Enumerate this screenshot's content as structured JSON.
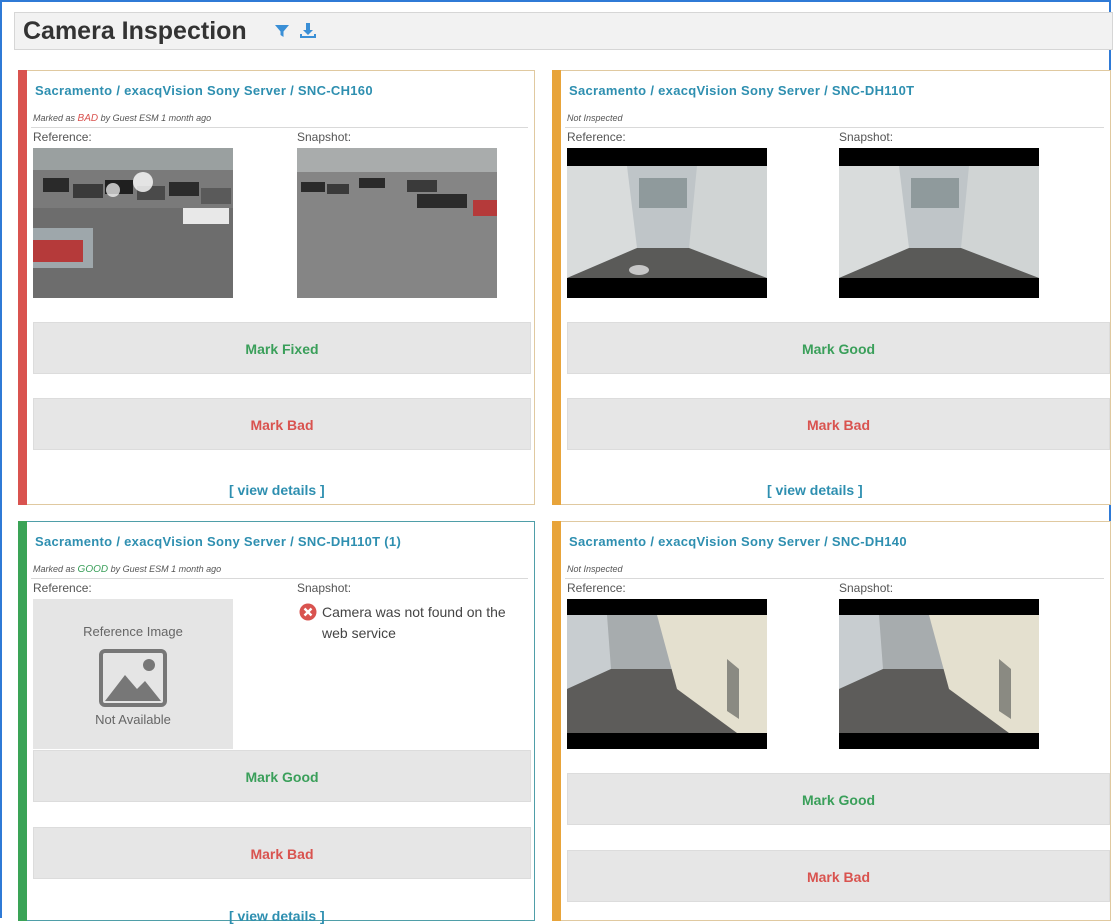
{
  "header": {
    "title": "Camera Inspection",
    "filter_icon": "filter-icon",
    "export_icon": "download-icon"
  },
  "labels": {
    "reference": "Reference:",
    "snapshot": "Snapshot:"
  },
  "colors": {
    "bad": "#d9534f",
    "good": "#3a9f5a",
    "uninspected": "#e8a43a",
    "link": "#2e8fb0"
  },
  "cameras": [
    {
      "title": "Sacramento / exacqVision Sony Server / SNC-CH160",
      "status_prefix": "Marked as",
      "status_value": "BAD",
      "status_suffix": "by Guest ESM 1 month ago",
      "primary_action": "Mark Fixed",
      "secondary_action": "Mark Bad",
      "details_link": "[ view details ]"
    },
    {
      "title": "Sacramento / exacqVision Sony Server / SNC-DH110T",
      "status_text": "Not Inspected",
      "primary_action": "Mark Good",
      "secondary_action": "Mark Bad",
      "details_link": "[ view details ]"
    },
    {
      "title": "Sacramento / exacqVision Sony Server / SNC-DH110T (1)",
      "status_prefix": "Marked as",
      "status_value": "GOOD",
      "status_suffix": "by Guest ESM 1 month ago",
      "reference_placeholder_title": "Reference Image",
      "reference_placeholder_caption": "Not Available",
      "snapshot_error": "Camera was not found on the web service",
      "primary_action": "Mark Good",
      "secondary_action": "Mark Bad",
      "details_link": "[ view details ]"
    },
    {
      "title": "Sacramento / exacqVision Sony Server / SNC-DH140",
      "status_text": "Not Inspected",
      "primary_action": "Mark Good",
      "secondary_action": "Mark Bad"
    }
  ]
}
